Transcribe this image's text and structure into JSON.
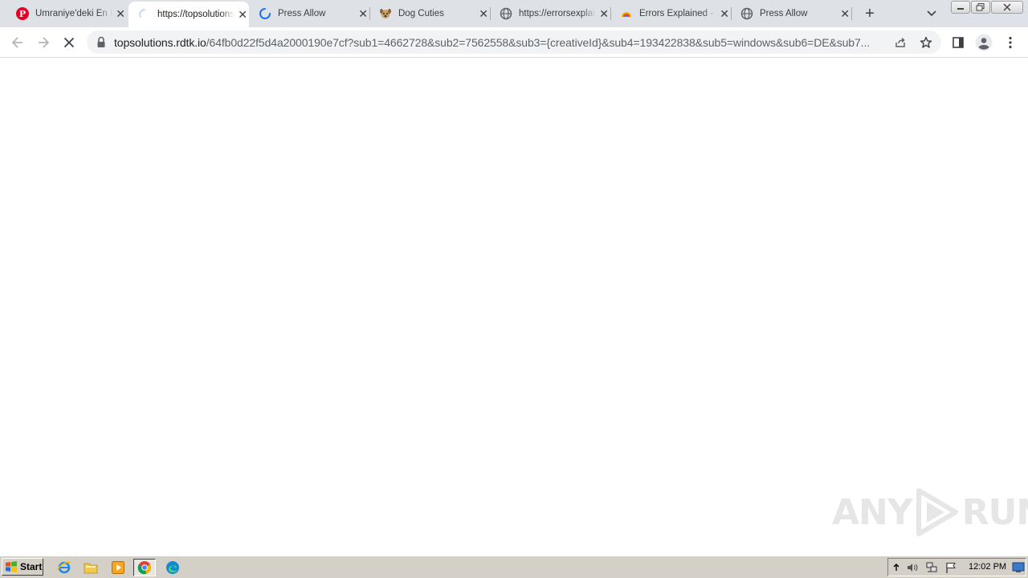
{
  "browser": {
    "tabs": [
      {
        "title": "Ümraniye'deki En İyi",
        "icon": "pinterest-icon",
        "active": false
      },
      {
        "title": "https://topsolutions.rdtk.io",
        "icon": "loading-spinner-icon",
        "active": true
      },
      {
        "title": "Press Allow",
        "icon": "loading-spinner-icon",
        "active": false
      },
      {
        "title": "Dog Cuties",
        "icon": "dog-favicon-icon",
        "active": false
      },
      {
        "title": "https://errorsexplained",
        "icon": "globe-icon",
        "active": false
      },
      {
        "title": "Errors Explained - ",
        "icon": "colorful-favicon-icon",
        "active": false
      },
      {
        "title": "Press Allow",
        "icon": "globe-icon",
        "active": false
      }
    ],
    "new_tab_icon": "plus-icon",
    "tab_search_icon": "chevron-down-icon",
    "window_controls": [
      "minimize-icon",
      "restore-icon",
      "close-icon"
    ]
  },
  "toolbar": {
    "back_icon": "arrow-left-icon",
    "forward_icon": "arrow-right-icon",
    "stop_icon": "stop-loading-icon",
    "lock_icon": "lock-icon",
    "url_host": "topsolutions.rdtk.io",
    "url_path": "/64fb0d22f5d4a2000190e7cf?sub1=4662728&sub2=7562558&sub3={creativeId}&sub4=193422838&sub5=windows&sub6=DE&sub7...",
    "share_icon": "share-icon",
    "bookmark_icon": "star-icon",
    "side_panel_icon": "side-panel-icon",
    "profile_icon": "profile-icon",
    "menu_icon": "kebab-menu-icon"
  },
  "watermark": {
    "left": "ANY",
    "right": "RUN"
  },
  "taskbar": {
    "start_label": "Start",
    "quick_launch": [
      "internet-explorer-icon",
      "folder-icon",
      "media-player-icon",
      "chrome-icon",
      "edge-icon"
    ],
    "tray_icons": [
      "show-hidden-icon",
      "volume-icon",
      "network-icon",
      "flag-icon"
    ],
    "clock": "12:02 PM",
    "show_desktop_icon": "show-desktop-icon"
  },
  "colors": {
    "tabstrip_bg": "#dee1e6",
    "omnibox_bg": "#f1f3f4",
    "taskbar_bg": "#d4d0c8",
    "spinner": "#1a73e8"
  }
}
